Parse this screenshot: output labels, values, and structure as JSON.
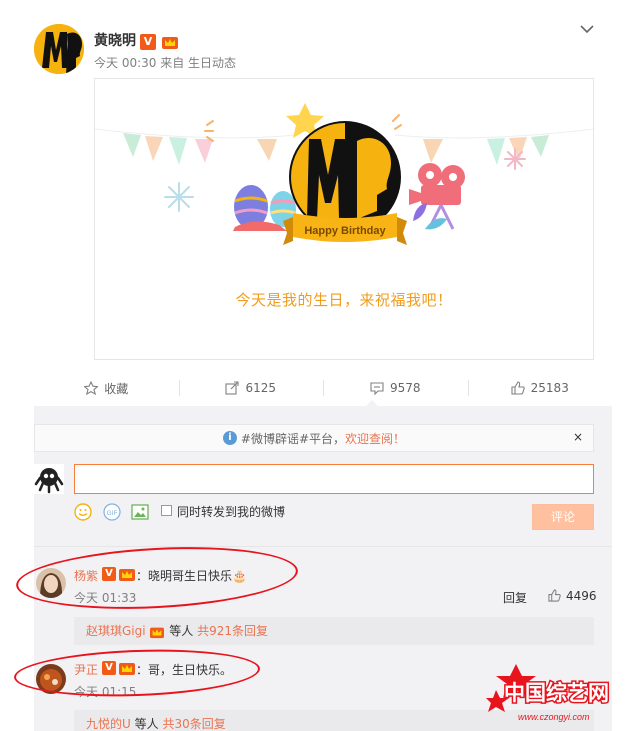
{
  "post": {
    "author": "黄晓明",
    "verified_badge": "V",
    "time_source": "今天 00:30 来自 生日动态",
    "birthday_badge": "Happy Birthday",
    "birthday_message": "今天是我的生日，来祝福我吧！"
  },
  "actions": {
    "favorite": "收藏",
    "repost_count": "6125",
    "comment_count": "9578",
    "like_count": "25183"
  },
  "notice": {
    "prefix": "#微博辟谣#平台，",
    "link": "欢迎查阅！",
    "close": "×",
    "info": "i"
  },
  "composer": {
    "placeholder": "",
    "repost_label": "同时转发到我的微博",
    "submit_label": "评论",
    "gif_label": "GIF"
  },
  "comments": [
    {
      "name": "杨紫",
      "text": "：晓明哥生日快乐🎂",
      "time": "今天 01:33",
      "reply_label": "回复",
      "likes": "4496",
      "replies_user": "赵琪琪Gigi",
      "replies_middle": "等人",
      "replies_count": "共921条回复"
    },
    {
      "name": "尹正",
      "text": "：哥，生日快乐。",
      "time": "今天 01:15",
      "replies_user": "九悦的U",
      "replies_middle": "等人",
      "replies_count": "共30条回复"
    }
  ],
  "watermark": {
    "title": "中国综艺网",
    "url": "www.czongyi.com"
  },
  "colors": {
    "accent": "#eb7350",
    "birthday_text": "#f09d1e",
    "avatar_yellow": "#f6b30f",
    "highlight_circle": "#e8141d"
  }
}
